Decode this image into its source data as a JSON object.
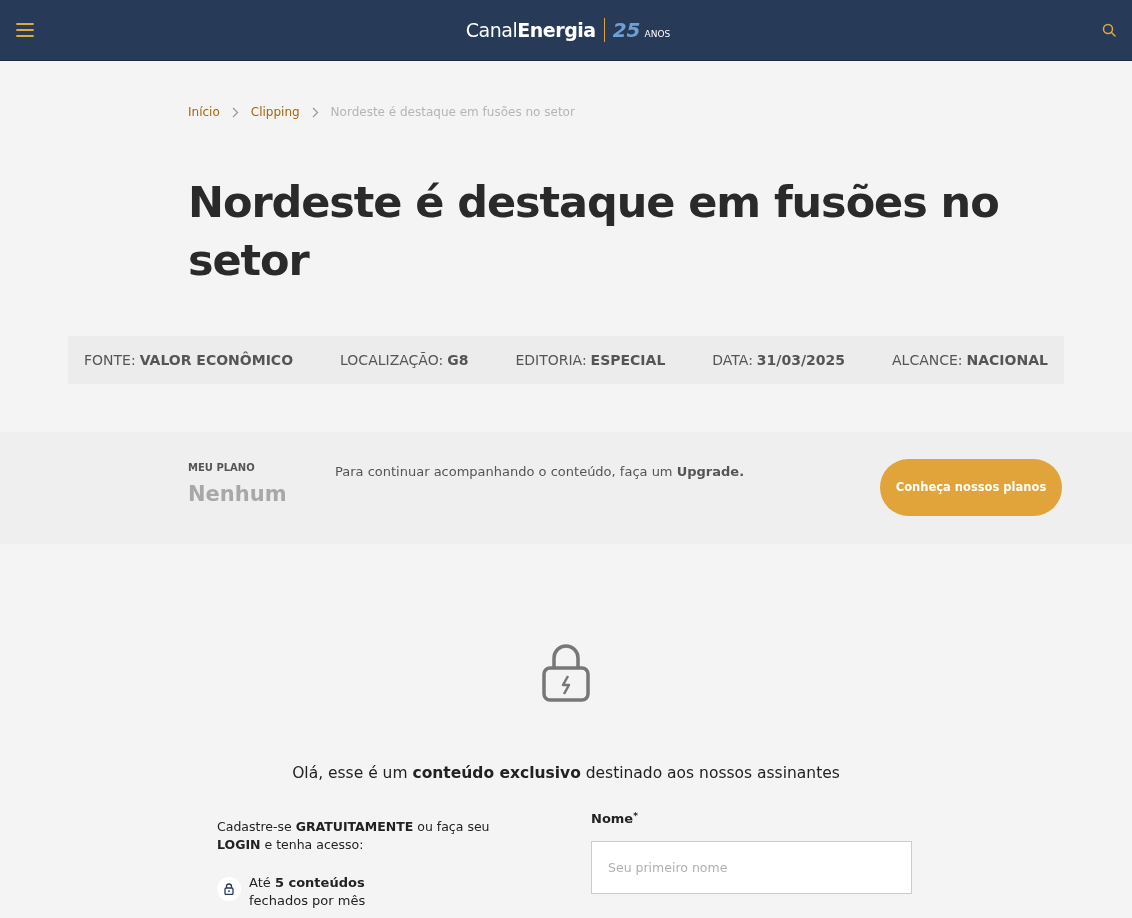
{
  "header": {
    "logo": {
      "name": "Canal**Energia**",
      "years": "25",
      "years_label": "ANOS"
    }
  },
  "breadcrumb": [
    {
      "label": "Início",
      "current": false
    },
    {
      "label": "Clipping",
      "current": false
    },
    {
      "label": "Nordeste é destaque em fusões no setor",
      "current": true
    }
  ],
  "title": "Nordeste é destaque em fusões no setor",
  "meta": [
    {
      "label": "FONTE:",
      "value": "VALOR ECONÔMICO"
    },
    {
      "label": "LOCALIZAÇÃO:",
      "value": "G8"
    },
    {
      "label": "EDITORIA:",
      "value": "ESPECIAL"
    },
    {
      "label": "DATA:",
      "value": "31/03/2025"
    },
    {
      "label": "ALCANCE:",
      "value": "NACIONAL"
    }
  ],
  "plan": {
    "label": "MEU PLANO",
    "value": "Nenhum",
    "message": "Para continuar acompanhando o conteúdo, faça um **Upgrade.**",
    "button": "Conheça nossos planos"
  },
  "paywall": {
    "heading": "Olá, esse é um **conteúdo exclusivo** destinado aos nossos assinantes",
    "intro": "Cadastre-se **GRATUITAMENTE** ou faça seu **LOGIN** e tenha acesso:",
    "benefits": [
      "Até **5 conteúdos** fechados por mês"
    ],
    "form": {
      "fields": [
        {
          "label": "Nome",
          "required_mark": "*",
          "placeholder": "Seu primeiro nome"
        }
      ]
    }
  }
}
